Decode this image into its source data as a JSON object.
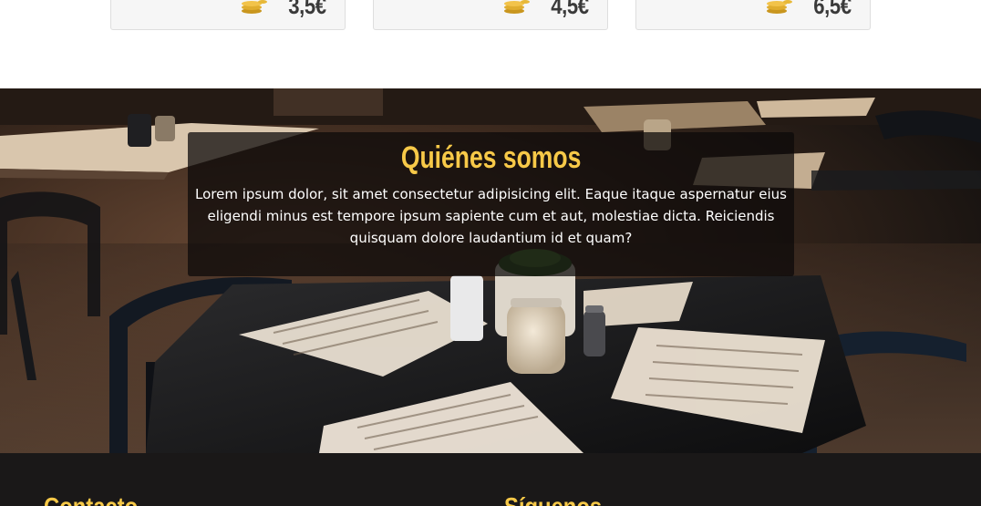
{
  "products": [
    {
      "price": "3,5€",
      "icon": "coins-icon"
    },
    {
      "price": "4,5€",
      "icon": "coins-icon"
    },
    {
      "price": "6,5€",
      "icon": "coins-icon"
    }
  ],
  "about": {
    "title": "Quiénes somos",
    "text": "Lorem ipsum dolor, sit amet consectetur adipisicing elit. Eaque itaque aspernatur eius eligendi minus est tempore ipsum sapiente cum et aut, molestiae dicta. Reiciendis quisquam dolore laudantium id et quam?"
  },
  "footer": {
    "contact_title": "Contacto",
    "follow_title": "Síguenos"
  },
  "colors": {
    "accent": "#f7c948",
    "footer_bg": "#1a1818",
    "card_bg": "#f6f6f6"
  }
}
